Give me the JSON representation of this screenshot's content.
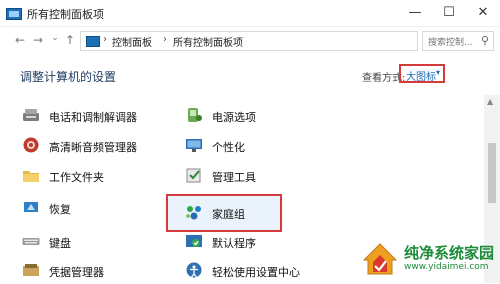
{
  "window": {
    "title": "所有控制面板项",
    "controls": {
      "minimize": "—",
      "maximize": "☐",
      "close": "✕"
    }
  },
  "address_bar": {
    "back": "←",
    "forward": "→",
    "recent": "⌄",
    "up": "↑",
    "crumbs": [
      "控制面板",
      "所有控制面板项"
    ],
    "separator": "›",
    "dropdown": "⌄",
    "refresh": "↻",
    "search_placeholder": "搜索控制...",
    "search_icon": "⚲"
  },
  "header": {
    "title": "调整计算机的设置",
    "view_by_label": "查看方式:",
    "view_by_value": "大图标",
    "view_by_caret": "▾"
  },
  "items": [
    {
      "label": "电话和调制解调器",
      "icon": "phone-modem-icon"
    },
    {
      "label": "电源选项",
      "icon": "power-options-icon"
    },
    {
      "label": "高清晰音频管理器",
      "icon": "audio-manager-icon"
    },
    {
      "label": "个性化",
      "icon": "personalization-icon"
    },
    {
      "label": "工作文件夹",
      "icon": "work-folders-icon"
    },
    {
      "label": "管理工具",
      "icon": "admin-tools-icon"
    },
    {
      "label": "恢复",
      "icon": "recovery-icon"
    },
    {
      "label": "家庭组",
      "icon": "homegroup-icon"
    },
    {
      "label": "键盘",
      "icon": "keyboard-icon"
    },
    {
      "label": "默认程序",
      "icon": "default-programs-icon"
    },
    {
      "label": "凭据管理器",
      "icon": "credential-manager-icon"
    },
    {
      "label": "轻松使用设置中心",
      "icon": "ease-of-access-icon"
    }
  ],
  "scrollbar": {
    "up": "▲"
  },
  "watermark": {
    "title": "纯净系统家园",
    "url": "www.yidaimei.com"
  },
  "colors": {
    "highlight_red": "#d33a3a",
    "link_blue": "#2168b6",
    "title_navy": "#1e3a5f",
    "watermark_green": "#1d8d3a"
  }
}
